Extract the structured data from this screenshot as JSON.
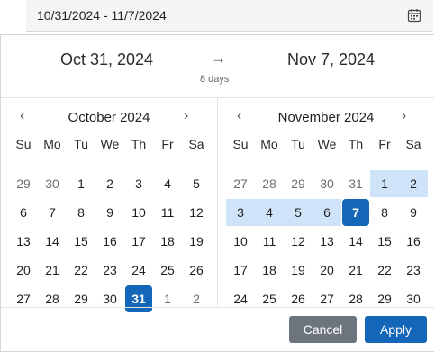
{
  "input": {
    "value": "10/31/2024 - 11/7/2024",
    "icon": "calendar-icon"
  },
  "summary": {
    "start": "Oct 31, 2024",
    "end": "Nov 7, 2024",
    "arrow": "→",
    "days": "8 days"
  },
  "nav": {
    "prev": "‹",
    "next": "›"
  },
  "calendars": [
    {
      "title": "October 2024",
      "weekdays": [
        "Su",
        "Mo",
        "Tu",
        "We",
        "Th",
        "Fr",
        "Sa"
      ],
      "weeks": [
        [
          {
            "d": "29",
            "s": "muted"
          },
          {
            "d": "30",
            "s": "muted"
          },
          {
            "d": "1"
          },
          {
            "d": "2"
          },
          {
            "d": "3"
          },
          {
            "d": "4"
          },
          {
            "d": "5"
          }
        ],
        [
          {
            "d": "6"
          },
          {
            "d": "7"
          },
          {
            "d": "8"
          },
          {
            "d": "9"
          },
          {
            "d": "10"
          },
          {
            "d": "11"
          },
          {
            "d": "12"
          }
        ],
        [
          {
            "d": "13"
          },
          {
            "d": "14"
          },
          {
            "d": "15"
          },
          {
            "d": "16"
          },
          {
            "d": "17"
          },
          {
            "d": "18"
          },
          {
            "d": "19"
          }
        ],
        [
          {
            "d": "20"
          },
          {
            "d": "21"
          },
          {
            "d": "22"
          },
          {
            "d": "23"
          },
          {
            "d": "24"
          },
          {
            "d": "25"
          },
          {
            "d": "26"
          }
        ],
        [
          {
            "d": "27"
          },
          {
            "d": "28"
          },
          {
            "d": "29"
          },
          {
            "d": "30"
          },
          {
            "d": "31",
            "s": "selected"
          },
          {
            "d": "1",
            "s": "muted"
          },
          {
            "d": "2",
            "s": "muted"
          }
        ]
      ]
    },
    {
      "title": "November 2024",
      "weekdays": [
        "Su",
        "Mo",
        "Tu",
        "We",
        "Th",
        "Fr",
        "Sa"
      ],
      "weeks": [
        [
          {
            "d": "27",
            "s": "muted"
          },
          {
            "d": "28",
            "s": "muted"
          },
          {
            "d": "29",
            "s": "muted"
          },
          {
            "d": "30",
            "s": "muted"
          },
          {
            "d": "31",
            "s": "muted"
          },
          {
            "d": "1",
            "s": "inrange"
          },
          {
            "d": "2",
            "s": "inrange"
          }
        ],
        [
          {
            "d": "3",
            "s": "inrange"
          },
          {
            "d": "4",
            "s": "inrange"
          },
          {
            "d": "5",
            "s": "inrange"
          },
          {
            "d": "6",
            "s": "inrange"
          },
          {
            "d": "7",
            "s": "selected"
          },
          {
            "d": "8"
          },
          {
            "d": "9"
          }
        ],
        [
          {
            "d": "10"
          },
          {
            "d": "11"
          },
          {
            "d": "12"
          },
          {
            "d": "13"
          },
          {
            "d": "14"
          },
          {
            "d": "15"
          },
          {
            "d": "16"
          }
        ],
        [
          {
            "d": "17"
          },
          {
            "d": "18"
          },
          {
            "d": "19"
          },
          {
            "d": "20"
          },
          {
            "d": "21"
          },
          {
            "d": "22"
          },
          {
            "d": "23"
          }
        ],
        [
          {
            "d": "24"
          },
          {
            "d": "25"
          },
          {
            "d": "26"
          },
          {
            "d": "27"
          },
          {
            "d": "28"
          },
          {
            "d": "29"
          },
          {
            "d": "30"
          }
        ]
      ]
    }
  ],
  "footer": {
    "cancel": "Cancel",
    "apply": "Apply"
  },
  "colors": {
    "accent": "#1366b8",
    "range": "#cfe4f8",
    "cancel": "#6c757d"
  }
}
